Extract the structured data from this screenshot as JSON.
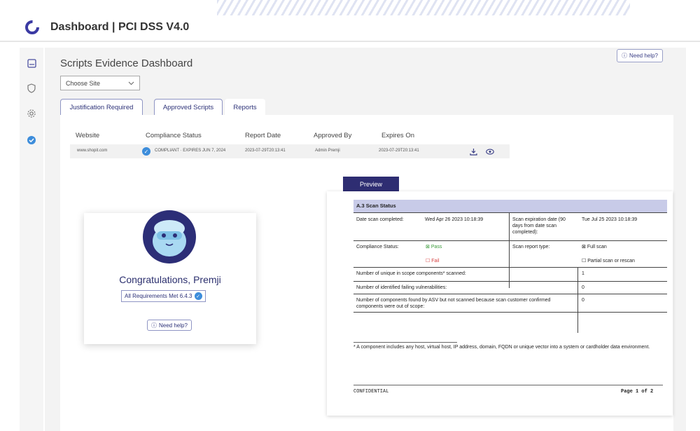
{
  "app": {
    "title": "Dashboard | PCI DSS V4.0"
  },
  "sidebar": {
    "items": [
      {
        "icon": "dashboard-icon"
      },
      {
        "icon": "shield-icon"
      },
      {
        "icon": "gear-icon"
      },
      {
        "icon": "check-badge-icon"
      }
    ]
  },
  "page": {
    "title": "Scripts Evidence Dashboard",
    "need_help": "Need help?",
    "site_select": "Choose Site"
  },
  "tabs": [
    "Justification Required",
    "Approved Scripts",
    "Reports"
  ],
  "table": {
    "headers": [
      "Website",
      "Compliance Status",
      "Report Date",
      "Approved By",
      "Expires On"
    ],
    "rows": [
      {
        "website": "www.shopit.com",
        "status": "COMPLIANT · EXPIRES JUN 7, 2024",
        "report_date": "2023-07-29T20:13:41",
        "approved_by": "Admin Premji",
        "expires_on": "2023-07-29T20:13:41"
      }
    ]
  },
  "card": {
    "greeting": "Congratulations, Premji",
    "requirements": "All Requirements Met 6.4.3",
    "need_help": "Need help?"
  },
  "preview": {
    "tab": "Preview",
    "section": "A.3 Scan Status",
    "date_completed_label": "Date scan completed:",
    "date_completed": "Wed Apr 26 2023 10:18:39",
    "expiration_label": "Scan expiration date (90 days from date scan completed):",
    "expiration": "Tue Jul 25 2023 10:18:39",
    "compliance_label": "Compliance Status:",
    "pass": "Pass",
    "fail": "Fail",
    "report_type_label": "Scan report type:",
    "full_scan": "Full scan",
    "partial_scan": "Partial scan or rescan",
    "unique_components_label": "Number of unique in scope components* scanned:",
    "unique_components": "1",
    "failing_vulns_label": "Number of identified failing vulnerabilities:",
    "failing_vulns": "0",
    "not_scanned_label": "Number of components found by ASV but not scanned because scan customer confirmed components were out of scope:",
    "not_scanned": "0",
    "footnote": "* A component includes any host, virtual host, IP address, domain, FQDN or unique vector into a system or cardholder data environment.",
    "footer_left": "CONFIDENTIAL",
    "footer_right": "Page 1 of 2"
  },
  "colors": {
    "accent": "#2e2d72",
    "check": "#3d8ddb",
    "pass": "#3a9a3a",
    "fail": "#d64040"
  }
}
